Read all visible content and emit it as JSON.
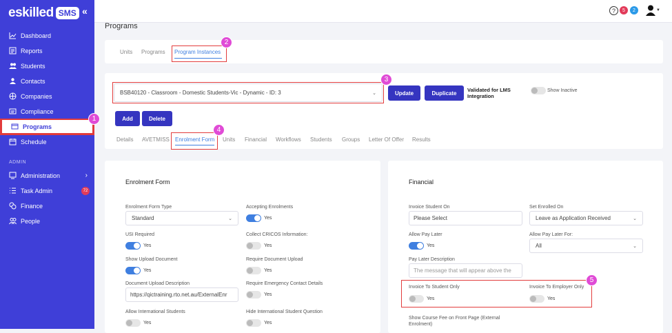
{
  "brand": {
    "logo_text": "eskilled",
    "logo_badge": "SMS",
    "collapse": "«"
  },
  "sidebar": {
    "items": [
      {
        "label": "Dashboard",
        "icon": "chart-icon"
      },
      {
        "label": "Reports",
        "icon": "report-icon"
      },
      {
        "label": "Students",
        "icon": "students-icon"
      },
      {
        "label": "Contacts",
        "icon": "contacts-icon"
      },
      {
        "label": "Companies",
        "icon": "companies-icon"
      },
      {
        "label": "Compliance",
        "icon": "compliance-icon"
      },
      {
        "label": "Programs",
        "icon": "programs-icon"
      },
      {
        "label": "Schedule",
        "icon": "calendar-icon"
      }
    ],
    "admin_heading": "ADMIN",
    "admin_items": [
      {
        "label": "Administration",
        "icon": "monitor-icon"
      },
      {
        "label": "Task Admin",
        "icon": "list-icon",
        "badge": "72"
      },
      {
        "label": "Finance",
        "icon": "coins-icon"
      },
      {
        "label": "People",
        "icon": "people-icon"
      }
    ]
  },
  "topbar": {
    "help": "?",
    "notif_red": "5",
    "notif_blue": "2"
  },
  "page": {
    "title": "Programs"
  },
  "tabs1": [
    "Units",
    "Programs",
    "Program Instances"
  ],
  "instance": {
    "selected": "BSB40120 - Classroom - Domestic Students-Vic - Dynamic - ID: 3",
    "update": "Update",
    "duplicate": "Duplicate",
    "validated": "Validated for LMS Integration",
    "show_inactive": "Show Inactive",
    "add": "Add",
    "delete": "Delete"
  },
  "tabs2": [
    "Details",
    "AVETMISS",
    "Enrolment Form",
    "Units",
    "Financial",
    "Workflows",
    "Students",
    "Groups",
    "Letter Of Offer",
    "Results"
  ],
  "callouts": [
    "1",
    "2",
    "3",
    "4",
    "5"
  ],
  "enrol": {
    "heading": "Enrolment Form",
    "form_type_label": "Enrolment Form Type",
    "form_type": "Standard",
    "accepting_label": "Accepting Enrolments",
    "usi_label": "USI Required",
    "cricos_label": "Collect CRICOS Information:",
    "upload_label": "Show Upload Document",
    "req_upload_label": "Require Document Upload",
    "doc_desc_label": "Document Upload Description",
    "doc_desc": "https://qictraining.rto.net.au/ExternalEnr",
    "emergency_label": "Require Emergency Contact Details",
    "intl_label": "Allow International Students",
    "hide_intl_label": "Hide International Student Question",
    "yes": "Yes"
  },
  "financial": {
    "heading": "Financial",
    "invoice_on_label": "Invoice Student On",
    "invoice_on": "Please Select",
    "set_enrolled_label": "Set Enrolled On",
    "set_enrolled": "Leave as Application Received",
    "allow_pay_later_label": "Allow Pay Later",
    "pay_later_for_label": "Allow Pay Later For:",
    "pay_later_for": "All",
    "pay_later_desc_label": "Pay Later Description",
    "pay_later_desc_ph": "The message that will appear above the",
    "inv_student_label": "Invoice To Student Only",
    "inv_employer_label": "Invoice To Employer Only",
    "show_fee_label": "Show Course Fee on Front Page (External Enrolment)",
    "yes": "Yes"
  }
}
